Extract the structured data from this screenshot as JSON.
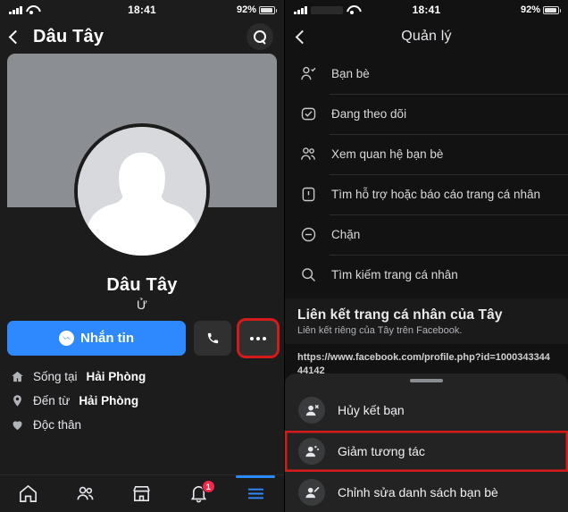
{
  "status_bar": {
    "time": "18:41",
    "battery": "92%"
  },
  "left_panel": {
    "nav": {
      "back_icon": "chevron-left-icon",
      "title": "Dâu Tây",
      "search_icon": "search-icon"
    },
    "profile": {
      "name": "Dâu Tây",
      "subtitle": "Ử",
      "avatar_alt": "default-female-avatar"
    },
    "actions": {
      "message_label": "Nhắn tin",
      "messenger_icon": "messenger-icon",
      "call_icon": "phone-icon",
      "more_icon": "more-horizontal-icon",
      "message_color": "#2e89ff",
      "highlight_color": "#d51a1a"
    },
    "info": [
      {
        "icon": "home-icon",
        "prefix": "Sống tại ",
        "bold": "Hải Phòng"
      },
      {
        "icon": "pin-icon",
        "prefix": "Đến từ ",
        "bold": "Hải Phòng"
      },
      {
        "icon": "heart-icon",
        "prefix": "Độc thân",
        "bold": ""
      }
    ],
    "bottom_nav": [
      {
        "icon": "home-icon",
        "name": "tab-home",
        "active": false,
        "badge": ""
      },
      {
        "icon": "friends-icon",
        "name": "tab-friends",
        "active": false,
        "badge": ""
      },
      {
        "icon": "marketplace-icon",
        "name": "tab-marketplace",
        "active": false,
        "badge": ""
      },
      {
        "icon": "bell-icon",
        "name": "tab-notifications",
        "active": false,
        "badge": "1"
      },
      {
        "icon": "menu-icon",
        "name": "tab-menu",
        "active": true,
        "badge": ""
      }
    ]
  },
  "right_panel": {
    "nav": {
      "back_icon": "chevron-left-icon",
      "title": "Quản lý"
    },
    "menu": [
      {
        "icon": "person-check-icon",
        "label": "Bạn bè"
      },
      {
        "icon": "following-icon",
        "label": "Đang theo dõi"
      },
      {
        "icon": "people-icon",
        "label": "Xem quan hệ bạn bè"
      },
      {
        "icon": "report-icon",
        "label": "Tìm hỗ trợ hoặc báo cáo trang cá nhân"
      },
      {
        "icon": "block-icon",
        "label": "Chặn"
      },
      {
        "icon": "search-icon",
        "label": "Tìm kiếm trang cá nhân"
      }
    ],
    "link_section": {
      "title": "Liên kết trang cá nhân của Tây",
      "description": "Liên kết riêng của Tây trên Facebook.",
      "url": "https://www.facebook.com/profile.php?id=100034334444142"
    },
    "sheet": [
      {
        "icon": "person-remove-icon",
        "label": "Hủy kết bạn",
        "highlight": false
      },
      {
        "icon": "person-snooze-icon",
        "label": "Giảm tương tác",
        "highlight": true
      },
      {
        "icon": "person-edit-icon",
        "label": "Chỉnh sửa danh sách bạn bè",
        "highlight": false
      }
    ]
  }
}
